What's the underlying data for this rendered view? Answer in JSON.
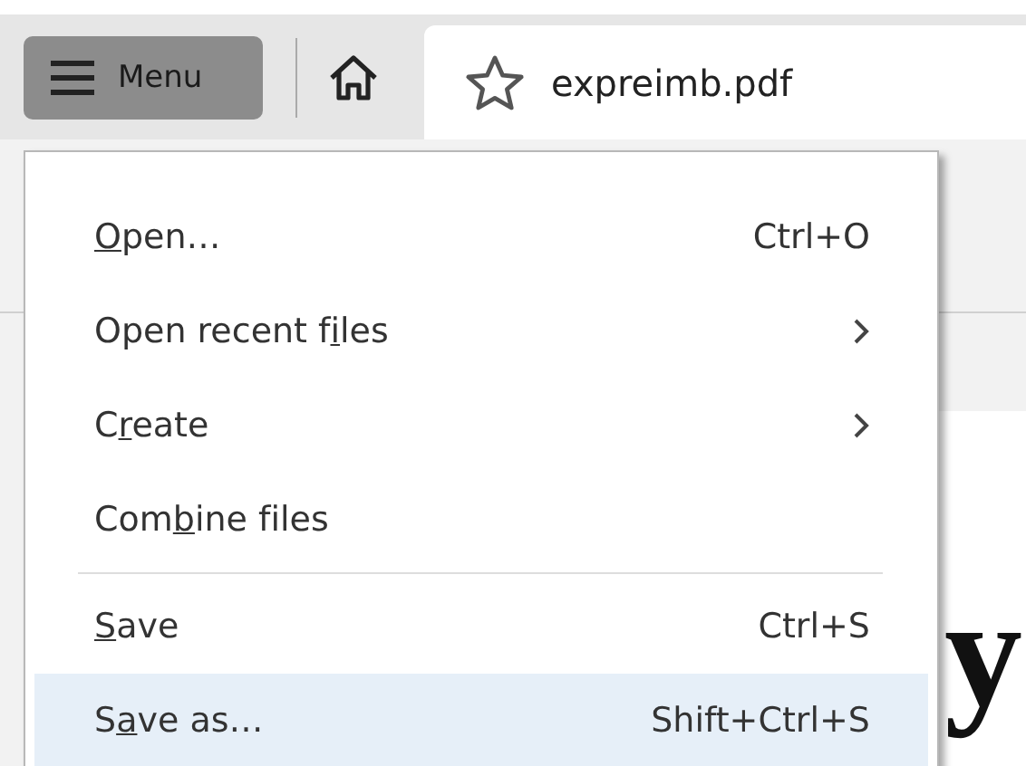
{
  "toolbar": {
    "menu_button": "Menu",
    "tab": {
      "title": "expreimb.pdf",
      "starred": false
    }
  },
  "document": {
    "visible_text": "y"
  },
  "menu": {
    "items": [
      {
        "kind": "command",
        "label_parts": [
          {
            "text": "O",
            "underlined": true
          },
          {
            "text": "pen…",
            "underlined": false
          }
        ],
        "shortcut": "Ctrl+O",
        "selected": false
      },
      {
        "kind": "submenu",
        "label_parts": [
          {
            "text": "Open recent f",
            "underlined": false
          },
          {
            "text": "i",
            "underlined": true
          },
          {
            "text": "les",
            "underlined": false
          }
        ],
        "selected": false
      },
      {
        "kind": "submenu",
        "label_parts": [
          {
            "text": "C",
            "underlined": false
          },
          {
            "text": "r",
            "underlined": true
          },
          {
            "text": "eate",
            "underlined": false
          }
        ],
        "selected": false
      },
      {
        "kind": "command",
        "label_parts": [
          {
            "text": "Com",
            "underlined": false
          },
          {
            "text": "b",
            "underlined": true
          },
          {
            "text": "ine files",
            "underlined": false
          }
        ],
        "selected": false
      },
      {
        "kind": "separator"
      },
      {
        "kind": "command",
        "label_parts": [
          {
            "text": "S",
            "underlined": true
          },
          {
            "text": "ave",
            "underlined": false
          }
        ],
        "shortcut": "Ctrl+S",
        "selected": false
      },
      {
        "kind": "command",
        "label_parts": [
          {
            "text": "S",
            "underlined": false
          },
          {
            "text": "a",
            "underlined": true
          },
          {
            "text": "ve as…",
            "underlined": false
          }
        ],
        "shortcut": "Shift+Ctrl+S",
        "selected": true
      }
    ]
  }
}
